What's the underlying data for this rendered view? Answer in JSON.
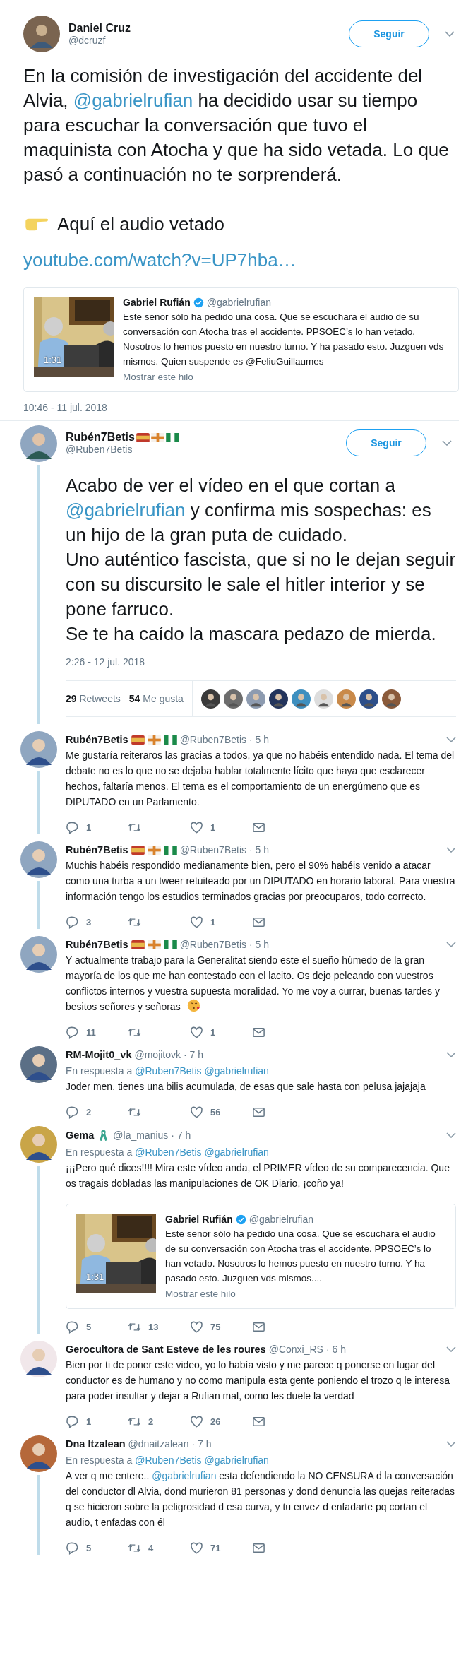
{
  "tweet": {
    "author": {
      "name": "Daniel Cruz",
      "handle": "@dcruzf"
    },
    "follow_button": "Seguir",
    "text": [
      {
        "text": "En la comisión de investigación del accidente del Alvia, "
      },
      {
        "text": "@gabrielrufian",
        "kind": "mention"
      },
      {
        "text": " ha decidido usar su tiempo para escuchar la conversación que tuvo el maquinista con Atocha y que ha sido vetada. Lo que pasó a continuación no te sorprenderá."
      }
    ],
    "audio_line": "Aquí el audio vetado",
    "link": "youtube.com/watch?v=UP7hba…",
    "quote": {
      "name": "Gabriel Rufián",
      "verified": true,
      "handle": "@gabrielrufian",
      "duration": "1:31",
      "text": "Este señor sólo ha pedido una cosa. Que se escuchara el audio de su conversación con Atocha tras el accidente. PPSOEC’s lo han vetado. Nosotros lo hemos puesto en nuestro turno. Y ha pasado esto. Juzguen vds mismos. Quien suspende es @FeliuGuillaumes",
      "show_thread": "Mostrar este hilo"
    },
    "timestamp": "10:46 - 11 jul. 2018"
  },
  "main_reply": {
    "author": {
      "name": "Rubén7Betis",
      "handle": "@Ruben7Betis",
      "badges": [
        {
          "kind": "spain-flag"
        },
        {
          "kind": "cross-flag"
        },
        {
          "kind": "green-flag"
        }
      ]
    },
    "follow_button": "Seguir",
    "thread_line": true,
    "text": [
      {
        "text": "Acabo de ver el vídeo en el que cortan a "
      },
      {
        "text": "@gabrielrufian",
        "kind": "mention"
      },
      {
        "text": " y confirma mis sospechas: es un hijo de la gran puta de cuidado.\nUno auténtico fascista, que si no le dejan seguir con su discursito le sale el hitler interior y se pone farruco.\nSe te ha caído la mascara pedazo de mierda."
      }
    ],
    "timestamp": "2:26 - 12 jul. 2018",
    "retweets": {
      "count": "29",
      "label": "Retweets"
    },
    "likes": {
      "count": "54",
      "label": "Me gusta"
    }
  },
  "replies": [
    {
      "author": {
        "name": "Rubén7Betis",
        "handle": "@Ruben7Betis",
        "badges": [
          {
            "kind": "spain-flag"
          },
          {
            "kind": "cross-flag"
          },
          {
            "kind": "green-flag"
          }
        ]
      },
      "time": "· 5 h",
      "thread_line": true,
      "text": [
        {
          "text": "Me gustaría reiteraros las gracias a todos, ya que no habéis entendido nada. El tema del debate no es lo que no se dejaba hablar totalmente lícito que haya que esclarecer hechos, faltaría menos. El tema es el comportamiento de un energúmeno que es DIPUTADO en un Parlamento."
        }
      ],
      "actions": {
        "replies": "1",
        "likes": "1"
      }
    },
    {
      "author": {
        "name": "Rubén7Betis",
        "handle": "@Ruben7Betis",
        "badges": [
          {
            "kind": "spain-flag"
          },
          {
            "kind": "cross-flag"
          },
          {
            "kind": "green-flag"
          }
        ]
      },
      "time": "· 5 h",
      "thread_line": true,
      "text": [
        {
          "text": "Muchis habéis respondido medianamente bien, pero el 90% habéis venido a atacar como una turba a un tweer retuiteado por un DIPUTADO en horario laboral. Para vuestra información tengo los estudios terminados gracias por preocuparos, todo correcto."
        }
      ],
      "actions": {
        "replies": "3",
        "likes": "1"
      }
    },
    {
      "author": {
        "name": "Rubén7Betis",
        "handle": "@Ruben7Betis",
        "badges": [
          {
            "kind": "spain-flag"
          },
          {
            "kind": "cross-flag"
          },
          {
            "kind": "green-flag"
          }
        ]
      },
      "time": "· 5 h",
      "thread_line": false,
      "text": [
        {
          "text": "Y actualmente trabajo para la Generalitat siendo este el sueño húmedo de la gran mayoría de los que me han contestado con el lacito. Os dejo peleando con vuestros conflictos internos y vuestra supuesta moralidad. Yo me voy a currar, buenas tardes y besitos señores y señoras "
        },
        {
          "kind": "kiss-emoji"
        }
      ],
      "actions": {
        "replies": "11",
        "likes": "1"
      }
    },
    {
      "author": {
        "name": "RM-Mojit0_vk",
        "handle": "@mojitovk"
      },
      "time": "· 7 h",
      "thread_line": false,
      "reply_to": {
        "label": "En respuesta a",
        "mentions": [
          "@Ruben7Betis",
          "@gabrielrufian"
        ]
      },
      "text": [
        {
          "text": "Joder men, tienes una bilis acumulada, de esas que sale hasta con pelusa jajajaja"
        }
      ],
      "actions": {
        "replies": "2",
        "likes": "56"
      }
    },
    {
      "author": {
        "name": "Gema",
        "handle": "@la_manius",
        "badges": [
          {
            "kind": "ribbon"
          }
        ]
      },
      "time": "· 7 h",
      "thread_line": true,
      "reply_to": {
        "label": "En respuesta a",
        "mentions": [
          "@Ruben7Betis",
          "@gabrielrufian"
        ]
      },
      "text": [
        {
          "text": "¡¡¡Pero qué dices!!!! Mira este vídeo anda, el PRIMER vídeo de su comparecencia. Que os tragais dobladas las manipulaciones de OK Diario, ¡coño ya!"
        }
      ],
      "quote": {
        "name": "Gabriel Rufián",
        "verified": true,
        "handle": "@gabrielrufian",
        "duration": "1:31",
        "text": "Este señor sólo ha pedido una cosa. Que se escuchara el audio de su conversación con Atocha tras el accidente. PPSOEC’s lo han vetado. Nosotros lo hemos puesto en nuestro turno. Y ha pasado esto. Juzguen vds mismos....",
        "show_thread": "Mostrar este hilo"
      },
      "actions": {
        "replies": "5",
        "retweets": "13",
        "likes": "75"
      }
    },
    {
      "author": {
        "name": "Gerocultora de Sant Esteve de les roures",
        "handle": "@Conxi_RS"
      },
      "time": "· 6 h",
      "thread_line": false,
      "text": [
        {
          "text": "Bien por ti de poner este video, yo lo había visto y me parece q ponerse en lugar del conductor es de humano y no como manipula esta gente poniendo el trozo q le interesa para poder insultar y dejar a Rufian mal, como les duele la verdad"
        }
      ],
      "actions": {
        "replies": "1",
        "retweets": "2",
        "likes": "26"
      }
    },
    {
      "author": {
        "name": "Dna Itzalean",
        "handle": "@dnaitzalean"
      },
      "time": "· 7 h",
      "thread_line": true,
      "reply_to": {
        "label": "En respuesta a",
        "mentions": [
          "@Ruben7Betis",
          "@gabrielrufian"
        ]
      },
      "text": [
        {
          "text": "A ver q me entere.. "
        },
        {
          "text": "@gabrielrufian",
          "kind": "mention"
        },
        {
          "text": " esta defendiendo la NO CENSURA d la conversación del conductor dl Alvia, dond murieron 81 personas y dond denuncia las quejas reiteradas q se hicieron sobre la peligrosidad d esa curva, y tu envez d enfadarte pq cortan el audio, t enfadas con él"
        }
      ],
      "actions": {
        "replies": "5",
        "retweets": "4",
        "likes": "71"
      }
    }
  ]
}
